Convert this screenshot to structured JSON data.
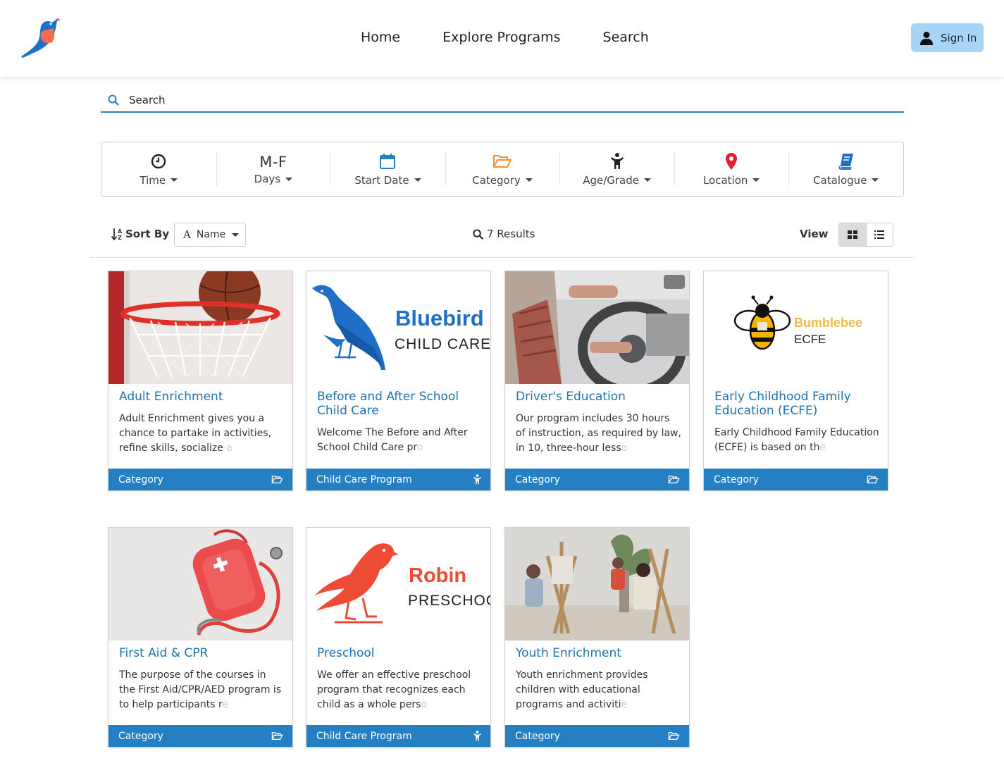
{
  "header": {
    "logo_icon": "bluebird-logo-icon",
    "nav": [
      "Home",
      "Explore Programs",
      "Search"
    ],
    "sign_in_label": "Sign In"
  },
  "search": {
    "placeholder": "Search"
  },
  "filters": [
    {
      "icon": "clock-icon",
      "label": "Time"
    },
    {
      "icon_text": "M-F",
      "label": "Days"
    },
    {
      "icon": "calendar-icon",
      "label": "Start Date"
    },
    {
      "icon": "folder-open-icon",
      "label": "Category"
    },
    {
      "icon": "child-icon",
      "label": "Age/Grade"
    },
    {
      "icon": "map-pin-icon",
      "label": "Location"
    },
    {
      "icon": "book-icon",
      "label": "Catalogue"
    }
  ],
  "toolbar": {
    "sort_label": "Sort By",
    "sort_value": "Name",
    "results_text": "7 Results",
    "view_label": "View"
  },
  "colors": {
    "accent": "#2480c3",
    "link": "#1f72b3",
    "signin_bg": "#a8d4f5",
    "pin": "#e5202e",
    "folder": "#f0913a"
  },
  "cards": [
    {
      "title": "Adult Enrichment",
      "desc_visible": "Adult Enrichment gives you a chance to partake in activities, refine skills, socialize",
      "desc_faded": " a",
      "footer": "Category",
      "footer_icon": "folder-open-icon"
    },
    {
      "title": "Before and After School Child Care",
      "logo_text_1": "Bluebird",
      "logo_text_2": "CHILD CARE",
      "desc_visible": "Welcome The Before and After School Child Care pr",
      "desc_faded": "o",
      "footer": "Child Care Program",
      "footer_icon": "child-icon"
    },
    {
      "title": "Driver's Education",
      "desc_visible": "Our program includes 30 hours of instruction, as required by law, in 10, three-hour less",
      "desc_faded": "o",
      "footer": "Category",
      "footer_icon": "folder-open-icon"
    },
    {
      "title": "Early Childhood Family Education (ECFE)",
      "logo_text_1": "Bumblebee",
      "logo_text_2": "ECFE",
      "desc_visible": "Early Childhood Family Education (ECFE) is based on th",
      "desc_faded": "e",
      "footer": "Category",
      "footer_icon": "folder-open-icon"
    },
    {
      "title": "First Aid & CPR",
      "desc_visible": "The purpose of the courses in the First Aid/CPR/AED program is to help participants r",
      "desc_faded": "e",
      "footer": "Category",
      "footer_icon": "folder-open-icon"
    },
    {
      "title": "Preschool",
      "logo_text_1": "Robin",
      "logo_text_2": "PRESCHOO",
      "desc_visible": "We offer an effective preschool program that recognizes each child as a whole pers",
      "desc_faded": "o",
      "footer": "Child Care Program",
      "footer_icon": "child-icon"
    },
    {
      "title": "Youth Enrichment",
      "desc_visible": "Youth enrichment provides children with educational programs and activiti",
      "desc_faded": "e",
      "footer": "Category",
      "footer_icon": "folder-open-icon"
    }
  ]
}
